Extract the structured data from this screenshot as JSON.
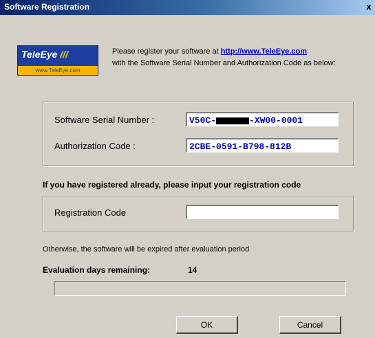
{
  "window": {
    "title": "Software Registration",
    "close_glyph": "x"
  },
  "logo": {
    "brand": "TeleEye",
    "slashes": "///",
    "website": "www.TeleEye.com"
  },
  "intro": {
    "line1_prefix": "Please register your software at ",
    "link": "http://www.TeleEye.com",
    "line2": "with the Software Serial Number and Authorization Code as below:"
  },
  "serial": {
    "label": "Software Serial Number :",
    "value_prefix": "V50C-",
    "value_suffix": "-XW00-0001",
    "redacted": true
  },
  "auth": {
    "label": "Authorization Code :",
    "value": "2CBE-0591-B798-812B"
  },
  "registered_prompt": "If you have registered already, please input your registration code",
  "registration": {
    "label": "Registration Code",
    "value": ""
  },
  "otherwise_note": "Otherwise, the software will be expired after evaluation period",
  "evaluation": {
    "label": "Evaluation days remaining:",
    "days": "14",
    "progress": 0
  },
  "buttons": {
    "ok": "OK",
    "cancel": "Cancel"
  }
}
